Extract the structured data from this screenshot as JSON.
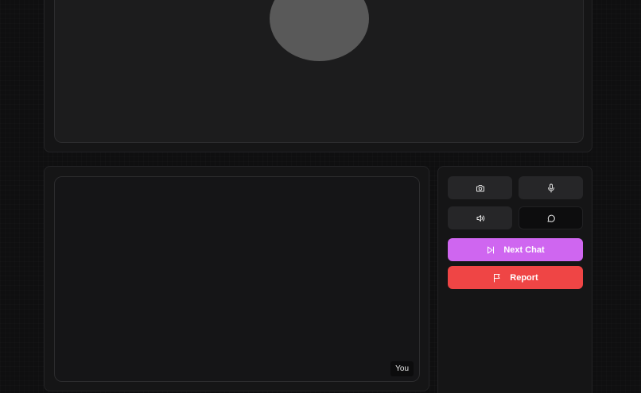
{
  "remote": {
    "avatar_icon": "user-avatar-placeholder"
  },
  "local": {
    "label": "You"
  },
  "controls": {
    "camera_icon": "camera-icon",
    "mic_icon": "microphone-icon",
    "speaker_icon": "speaker-icon",
    "chat_icon": "chat-bubble-icon",
    "next_label": "Next Chat",
    "next_icon": "skip-forward-icon",
    "report_label": "Report",
    "report_icon": "flag-icon"
  },
  "colors": {
    "next_button": "#cf66f0",
    "report_button": "#ef4545",
    "background": "#0f0f10",
    "panel": "#151516"
  }
}
